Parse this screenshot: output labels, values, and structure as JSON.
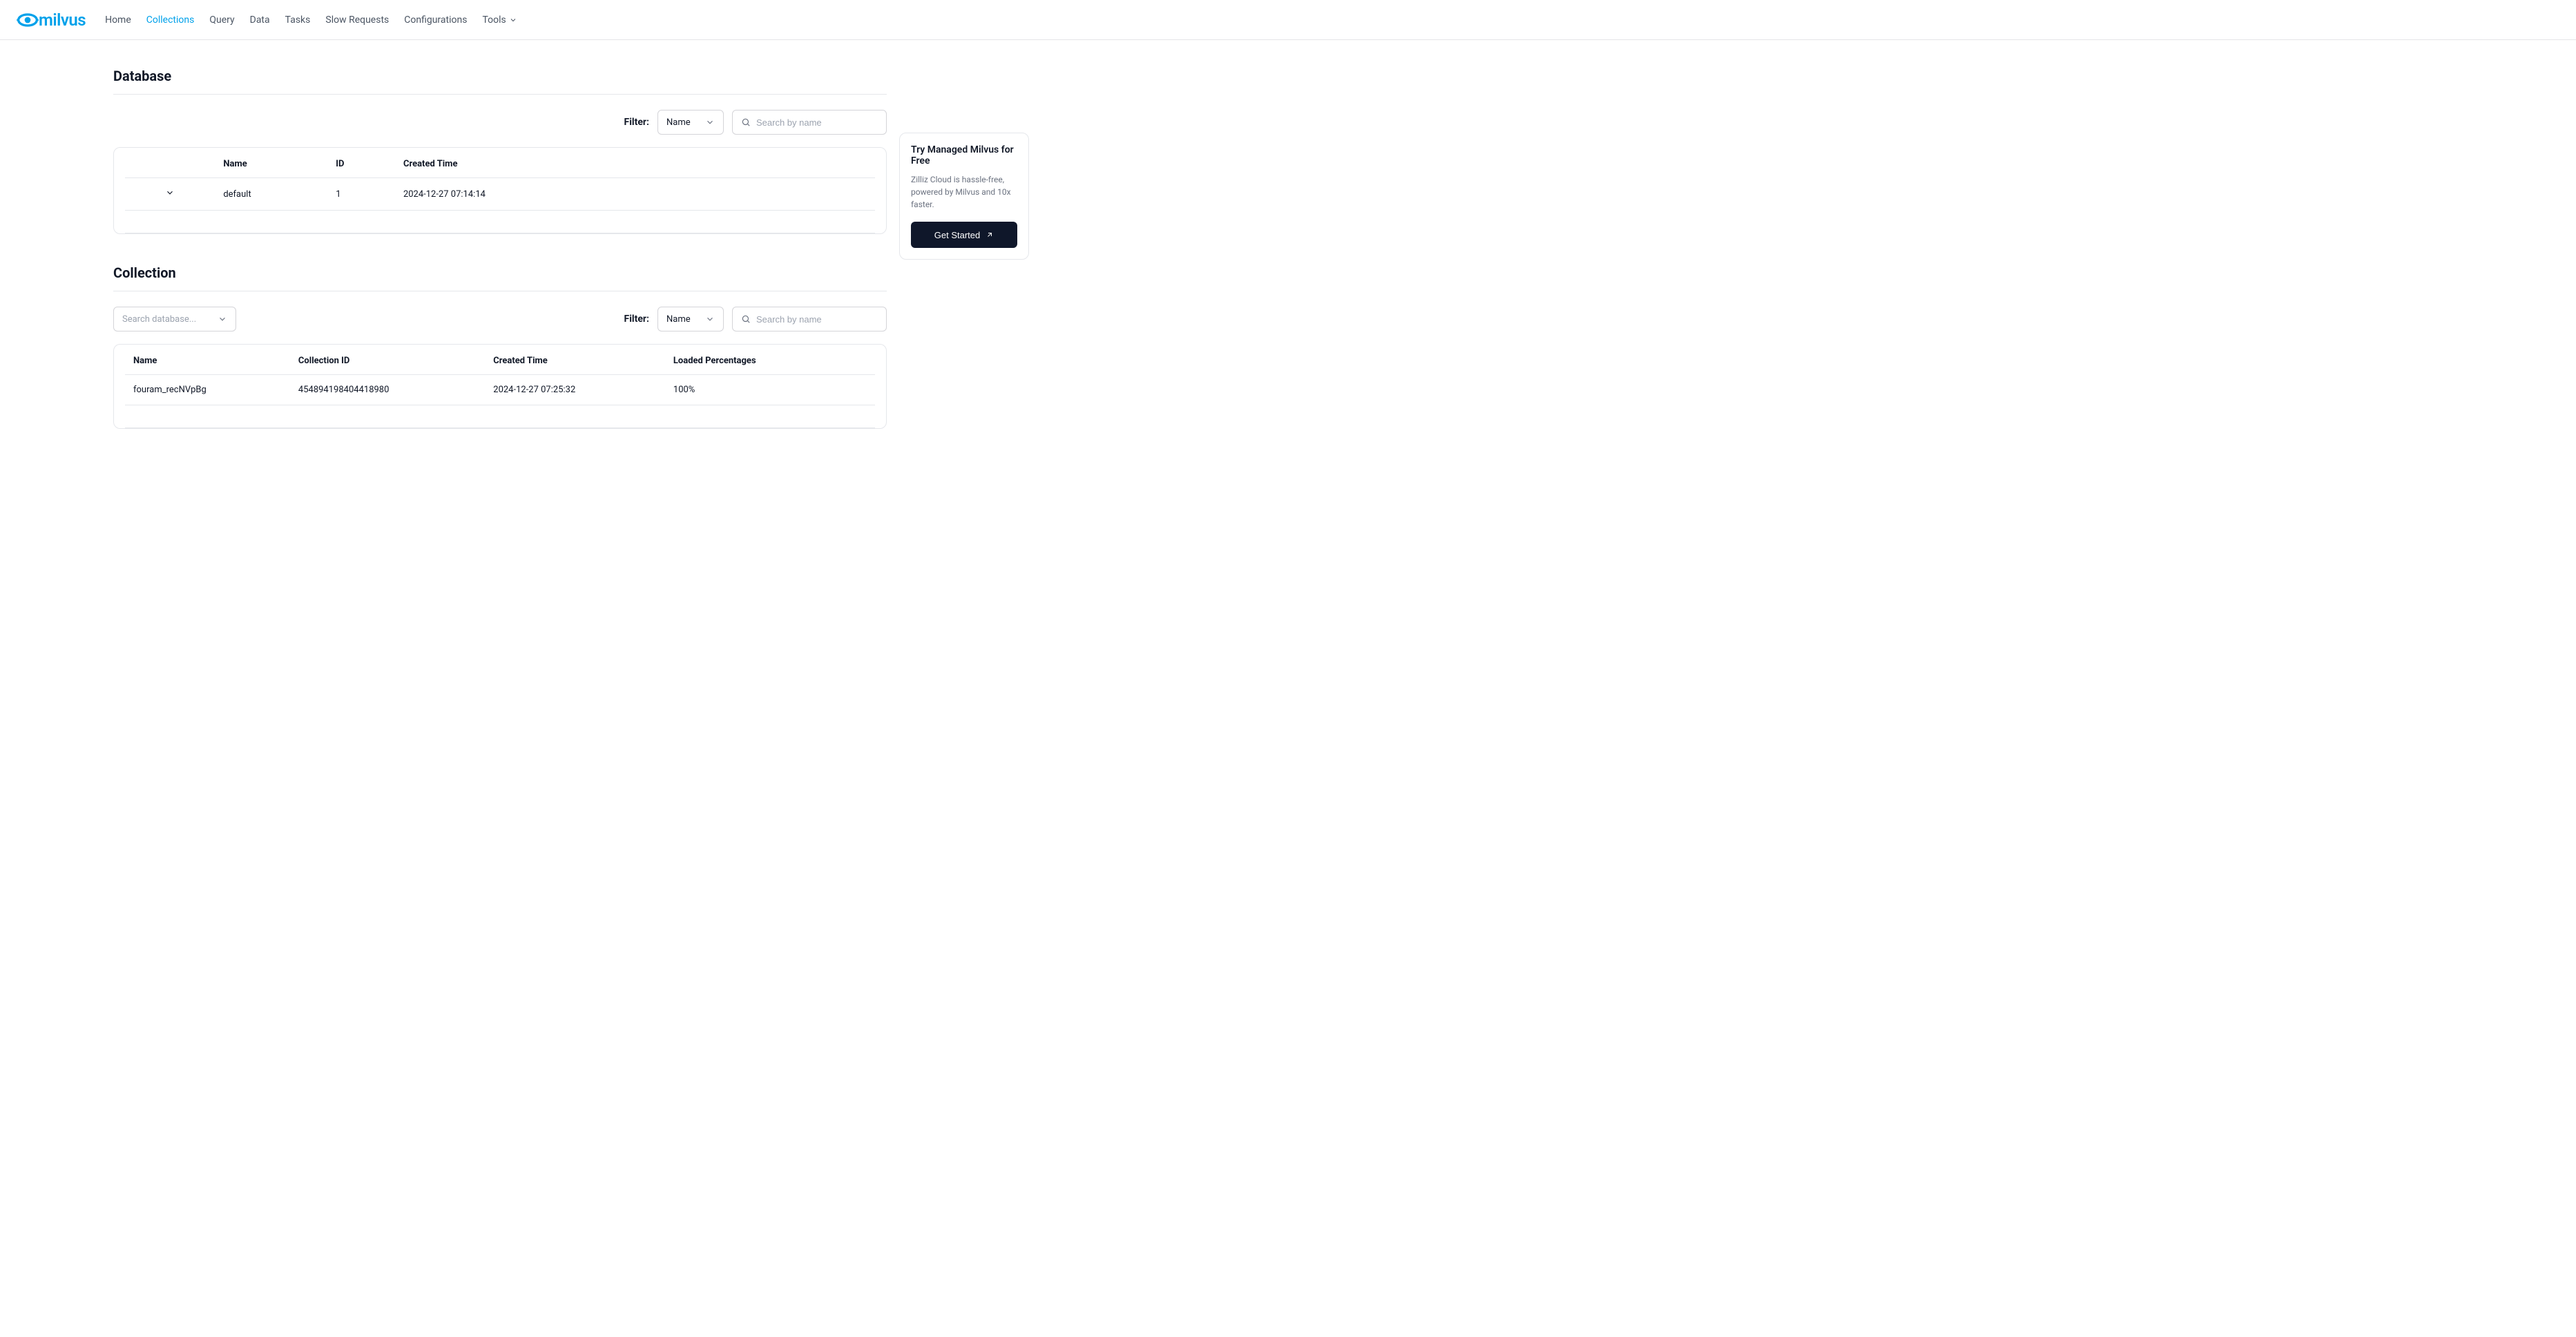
{
  "brand": "milvus",
  "nav": {
    "home": "Home",
    "collections": "Collections",
    "query": "Query",
    "data": "Data",
    "tasks": "Tasks",
    "slow": "Slow Requests",
    "config": "Configurations",
    "tools": "Tools"
  },
  "database": {
    "title": "Database",
    "filter_label": "Filter:",
    "filter_select": "Name",
    "search_placeholder": "Search by name",
    "headers": {
      "name": "Name",
      "id": "ID",
      "created": "Created Time"
    },
    "rows": [
      {
        "name": "default",
        "id": "1",
        "created": "2024-12-27 07:14:14"
      }
    ]
  },
  "collection": {
    "title": "Collection",
    "db_select_placeholder": "Search database...",
    "filter_label": "Filter:",
    "filter_select": "Name",
    "search_placeholder": "Search by name",
    "headers": {
      "name": "Name",
      "id": "Collection ID",
      "created": "Created Time",
      "loaded": "Loaded Percentages"
    },
    "rows": [
      {
        "name": "fouram_recNVpBg",
        "id": "454894198404418980",
        "created": "2024-12-27 07:25:32",
        "loaded": "100%"
      }
    ]
  },
  "promo": {
    "title": "Try Managed Milvus for Free",
    "desc": "Zilliz Cloud is hassle-free, powered by Milvus and 10x faster.",
    "button": "Get Started"
  }
}
